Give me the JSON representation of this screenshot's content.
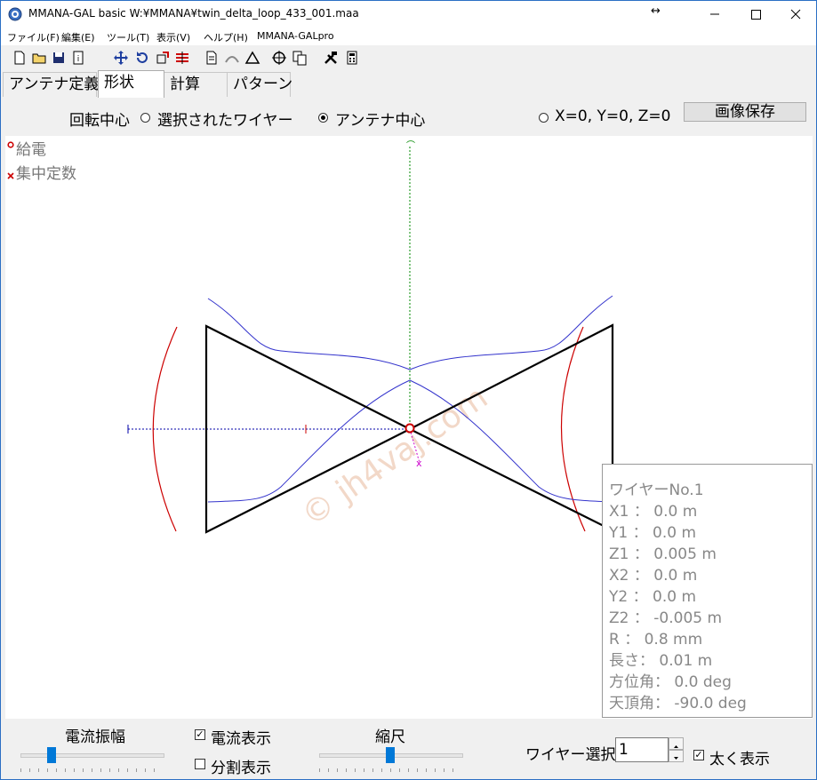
{
  "window": {
    "title": "MMANA-GAL basic  W:¥MMANA¥twin_delta_loop_433_001.maa",
    "resize_glyph": "↔"
  },
  "menu": {
    "items": [
      "ファイル(F)",
      "編集(E)",
      "ツール(T)",
      "表示(V)",
      "ヘルプ(H)",
      "MMANA-GALpro"
    ]
  },
  "tabs": [
    {
      "label": "アンテナ定義",
      "active": false
    },
    {
      "label": "形状",
      "active": true
    },
    {
      "label": "計算",
      "active": false
    },
    {
      "label": "パターン",
      "active": false
    }
  ],
  "rotation": {
    "label": "回転中心",
    "options": [
      {
        "label": "選択されたワイヤー",
        "selected": false
      },
      {
        "label": "アンテナ中心",
        "selected": true
      },
      {
        "label": "X=0, Y=0, Z=0",
        "selected": false
      }
    ],
    "save_image_label": "画像保存"
  },
  "legend": {
    "feed_label": "給電",
    "load_label": "集中定数",
    "feed_color": "#cc0000",
    "load_color": "#cc0000"
  },
  "watermark": "© jh4vaj.com",
  "wire_info": {
    "title": "ワイヤーNo.1",
    "lines": [
      "X1   ：  0.0 m",
      "Y1   ：  0.0 m",
      "Z1   ：  0.005 m",
      "X2   ：  0.0 m",
      "Y2   ：  0.0 m",
      "Z2   ：  -0.005 m",
      "R     ：  0.8 mm",
      "長さ：  0.01 m",
      "方位角：  0.0 deg",
      "天頂角：  -90.0 deg"
    ]
  },
  "bottom": {
    "current_amplitude_label": "電流振幅",
    "current_amplitude_level": 0.2,
    "show_current_label": "電流表示",
    "show_current_checked": true,
    "show_segments_label": "分割表示",
    "show_segments_checked": false,
    "scale_label": "縮尺",
    "scale_level": 0.5,
    "wire_select_label": "ワイヤー選択",
    "wire_select_value": "1",
    "bold_label": "太く表示",
    "bold_checked": true
  },
  "colors": {
    "titlebar_accent": "#2b6fc4",
    "current_line": "#3333cc",
    "far_field": "#cc0000",
    "axis_z": "#008800",
    "axis_x": "#0000aa",
    "axis_y": "#cc00cc",
    "slider_thumb": "#0078d7"
  }
}
